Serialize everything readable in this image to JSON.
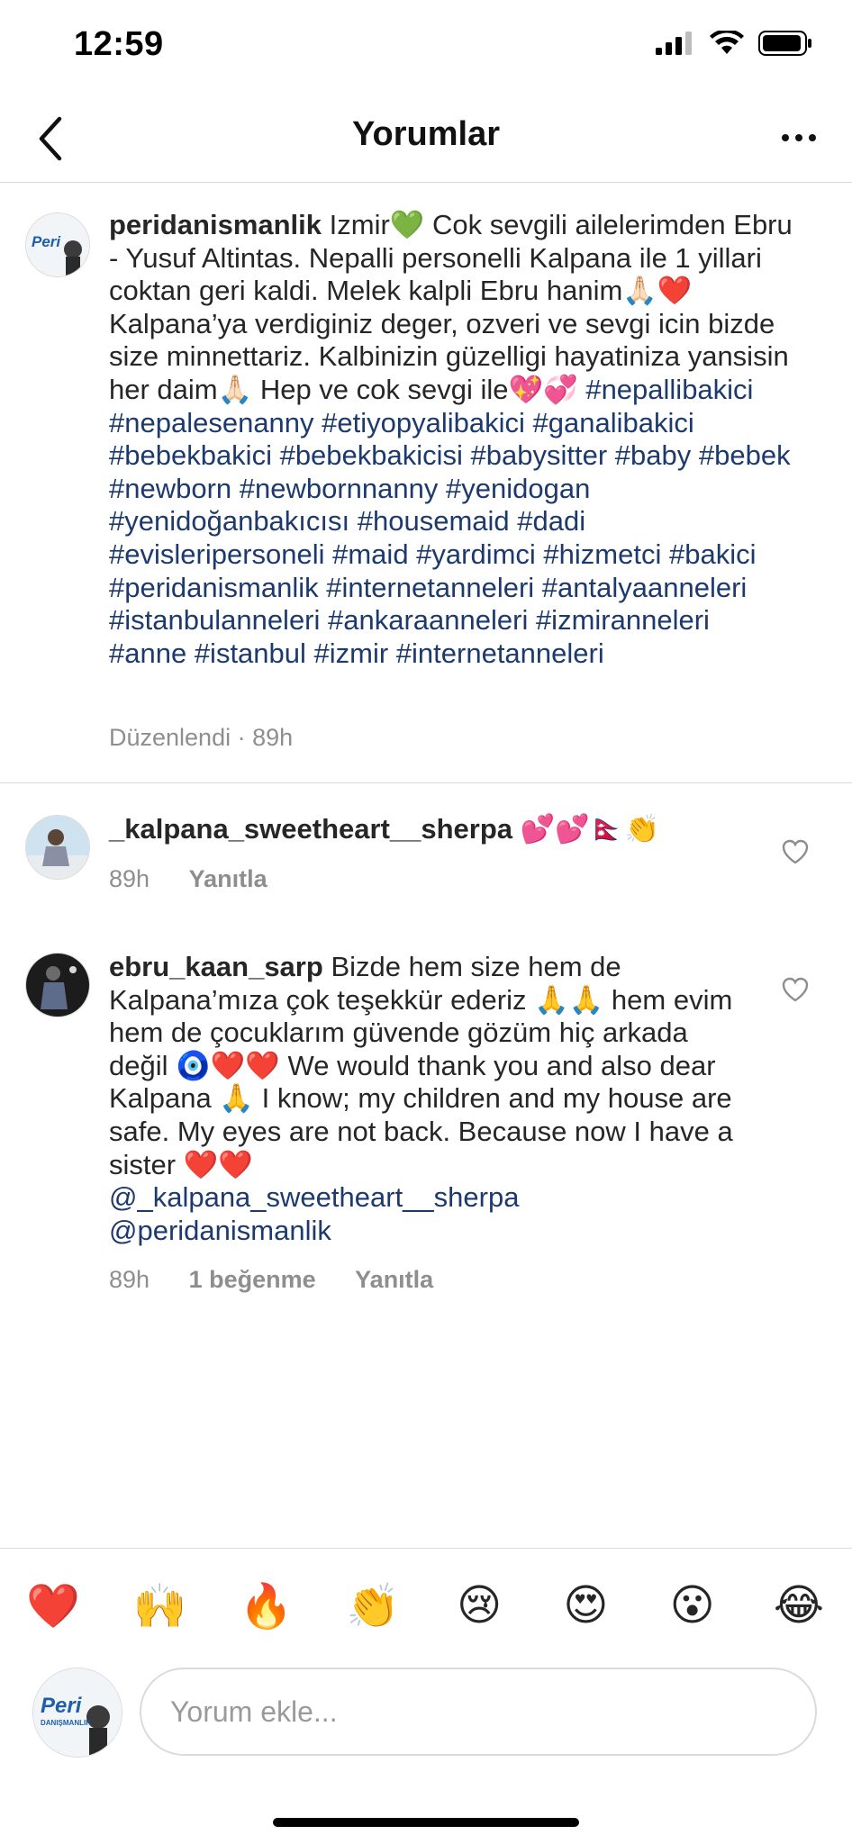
{
  "status": {
    "time": "12:59"
  },
  "header": {
    "title": "Yorumlar"
  },
  "post": {
    "username": "peridanismanlik",
    "text": "Izmir💚 Cok sevgili ailelerimden Ebru - Yusuf Altintas. Nepalli personelli Kalpana ile 1 yillari coktan geri kaldi. Melek kalpli Ebru hanim🙏🏻❤️ Kalpana’ya verdiginiz deger, ozveri ve sevgi icin bizde size minnettariz. Kalbinizin güzelligi hayatiniza yansisin her daim🙏🏻 Hep ve cok sevgi ile💖💞",
    "hashtags": "#nepallibakici #nepalesenanny #etiyopyalibakici #ganalibakici #bebekbakici #bebekbakicisi #babysitter #baby #bebek #newborn #newbornnanny #yenidogan #yenidoğanbakıcısı #housemaid #dadi #evisleripersoneli #maid #yardimci #hizmetci #bakici #peridanismanlik #internetanneleri #antalyaanneleri #istanbulanneleri #ankaraanneleri #izmiranneleri #anne #istanbul #izmir #internetanneleri",
    "edited": "Düzenlendi · 89h",
    "avatar_text": "Peri",
    "avatar_subtext": "DANIŞMANLIK"
  },
  "comments": [
    {
      "username": "_kalpana_sweetheart__sherpa",
      "text": "💕💕🇳🇵👏",
      "time": "89h",
      "reply": "Yanıtla"
    },
    {
      "username": "ebru_kaan_sarp",
      "text": "Bizde hem size hem de Kalpana’mıza çok teşekkür ederiz 🙏🙏 hem evim hem de çocuklarım güvende gözüm hiç arkada değil 🧿❤️❤️ We would thank you and also dear Kalpana 🙏 I know; my children and my house are safe. My eyes are not back. Because now I have a sister ❤️❤️",
      "mention1": "@_kalpana_sweetheart__sherpa",
      "mention2": "@peridanismanlik",
      "time": "89h",
      "likes": "1 beğenme",
      "reply": "Yanıtla"
    }
  ],
  "reactions": [
    "❤️",
    "🙌",
    "🔥",
    "👏",
    "😢",
    "😍",
    "😮",
    "😂"
  ],
  "input": {
    "placeholder": "Yorum ekle..."
  },
  "colors": {
    "hashtag": "#1d3a6e",
    "meta": "#8e8e8e",
    "divider": "#dbdbdb"
  }
}
